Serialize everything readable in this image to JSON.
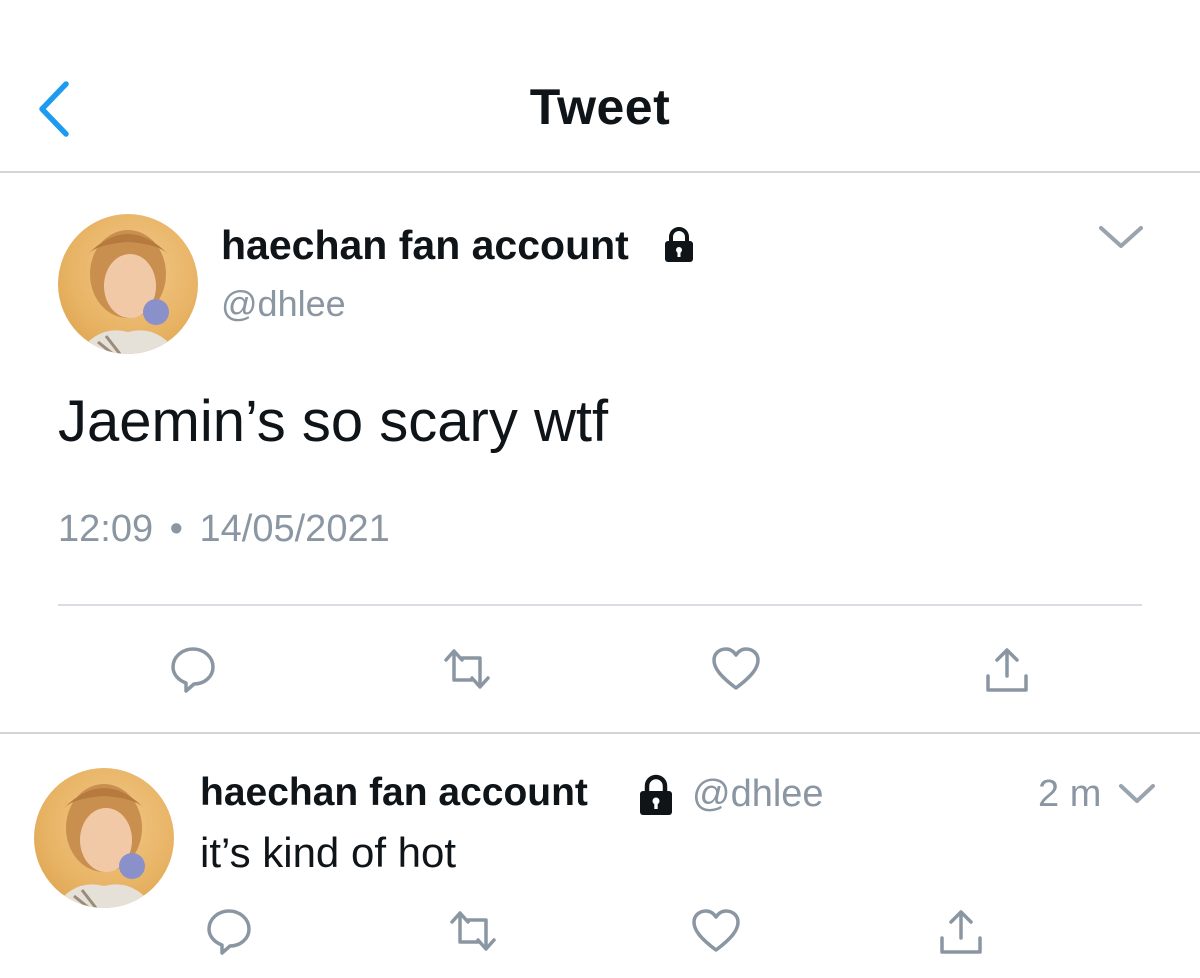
{
  "header": {
    "title": "Tweet",
    "back_icon": "chevron-left-icon",
    "accent_color": "#1d9bf0"
  },
  "main_tweet": {
    "display_name": "haechan fan account",
    "handle": "@dhlee",
    "protected_icon": "lock-icon",
    "text": "Jaemin’s so scary wtf",
    "time": "12:09",
    "separator": "•",
    "date": "14/05/2021",
    "menu_icon": "chevron-down-icon",
    "actions": [
      "reply-icon",
      "retweet-icon",
      "like-icon",
      "share-icon"
    ]
  },
  "reply_tweet": {
    "display_name": "haechan fan account",
    "handle": "@dhlee",
    "protected_icon": "lock-icon",
    "time_ago": "2 m",
    "text": "it’s kind of hot",
    "menu_icon": "chevron-down-icon",
    "actions": [
      "reply-icon",
      "retweet-icon",
      "like-icon",
      "share-icon"
    ]
  },
  "colors": {
    "primary_text": "#0f1419",
    "secondary_text": "#8b96a3",
    "divider": "#d4d4d8",
    "icon_gray": "#8b96a3"
  }
}
